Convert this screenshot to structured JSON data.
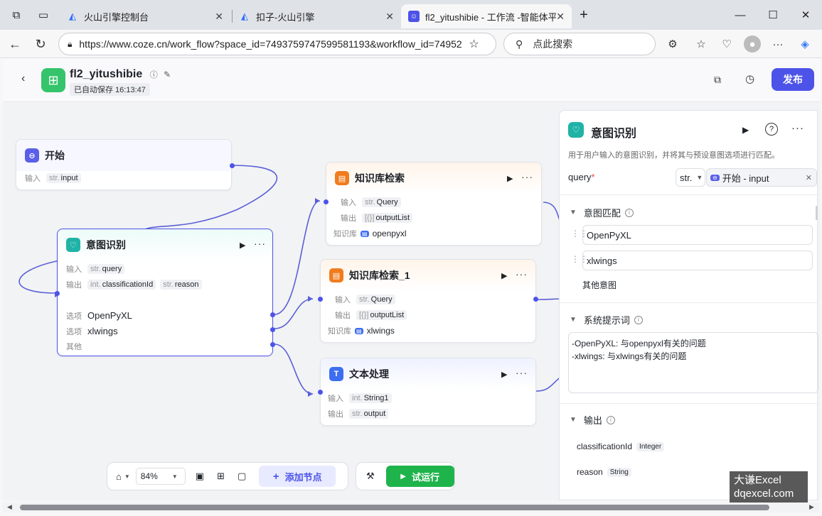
{
  "browser": {
    "tabs": [
      {
        "label": "火山引擎控制台"
      },
      {
        "label": "扣子-火山引擎"
      },
      {
        "label": "fl2_yitushibie - 工作流 -智能体平台"
      }
    ],
    "url": "https://www.coze.cn/work_flow?space_id=7493759747599581193&workflow_id=74952...",
    "search_placeholder": "点此搜索"
  },
  "app": {
    "title": "fl2_yitushibie",
    "autosave": "已自动保存 16:13:47",
    "publish_label": "发布"
  },
  "nodes": {
    "start": {
      "title": "开始",
      "input_label": "输入",
      "input_type": "str.",
      "input_name": "input"
    },
    "intent": {
      "title": "意图识别",
      "in_label": "输入",
      "in_type": "str.",
      "in_name": "query",
      "out_label": "输出",
      "out1_type": "int.",
      "out1_name": "classificationId",
      "out2_type": "str.",
      "out2_name": "reason",
      "opt_label": "选项",
      "opt1": "OpenPyXL",
      "opt2": "xlwings",
      "other_label": "其他"
    },
    "kb1": {
      "title": "知识库检索",
      "in_label": "输入",
      "in_type": "str.",
      "in_name": "Query",
      "out_label": "输出",
      "out_type": "[{}]",
      "out_name": "outputList",
      "kb_label": "知识库",
      "kb_name": "openpyxl"
    },
    "kb2": {
      "title": "知识库检索_1",
      "in_label": "输入",
      "in_type": "str.",
      "in_name": "Query",
      "out_label": "输出",
      "out_type": "[{}]",
      "out_name": "outputList",
      "kb_label": "知识库",
      "kb_name": "xlwings"
    },
    "text": {
      "title": "文本处理",
      "in_label": "输入",
      "in_type": "int.",
      "in_name": "String1",
      "out_label": "输出",
      "out_type": "str.",
      "out_name": "output"
    }
  },
  "panel": {
    "title": "意图识别",
    "desc": "用于用户输入的意图识别，并将其与预设意图选项进行匹配。",
    "query_label": "query",
    "query_required": "*",
    "query_type": "str.",
    "query_ref": "开始 - input",
    "intent_section": "意图匹配",
    "intents": [
      "OpenPyXL",
      "xlwings"
    ],
    "other_intent": "其他意图",
    "sysprompt_section": "系统提示词",
    "sysprompt_lines": [
      "-OpenPyXL: 与openpyxl有关的问题",
      "-xlwings: 与xlwings有关的问题"
    ],
    "output_section": "输出",
    "outputs": [
      {
        "name": "classificationId",
        "type": "Integer"
      },
      {
        "name": "reason",
        "type": "String"
      }
    ]
  },
  "toolbar": {
    "zoom": "84%",
    "add_node": "添加节点",
    "run": "试运行"
  },
  "watermark": {
    "line1": "大谦Excel",
    "line2": "dqexcel.com"
  },
  "colors": {
    "accent": "#4d53e8",
    "run": "#1fb34b",
    "intent_icon": "#1fb3a6",
    "kb_icon": "#f07c1e",
    "text_icon": "#3d6ef0"
  }
}
